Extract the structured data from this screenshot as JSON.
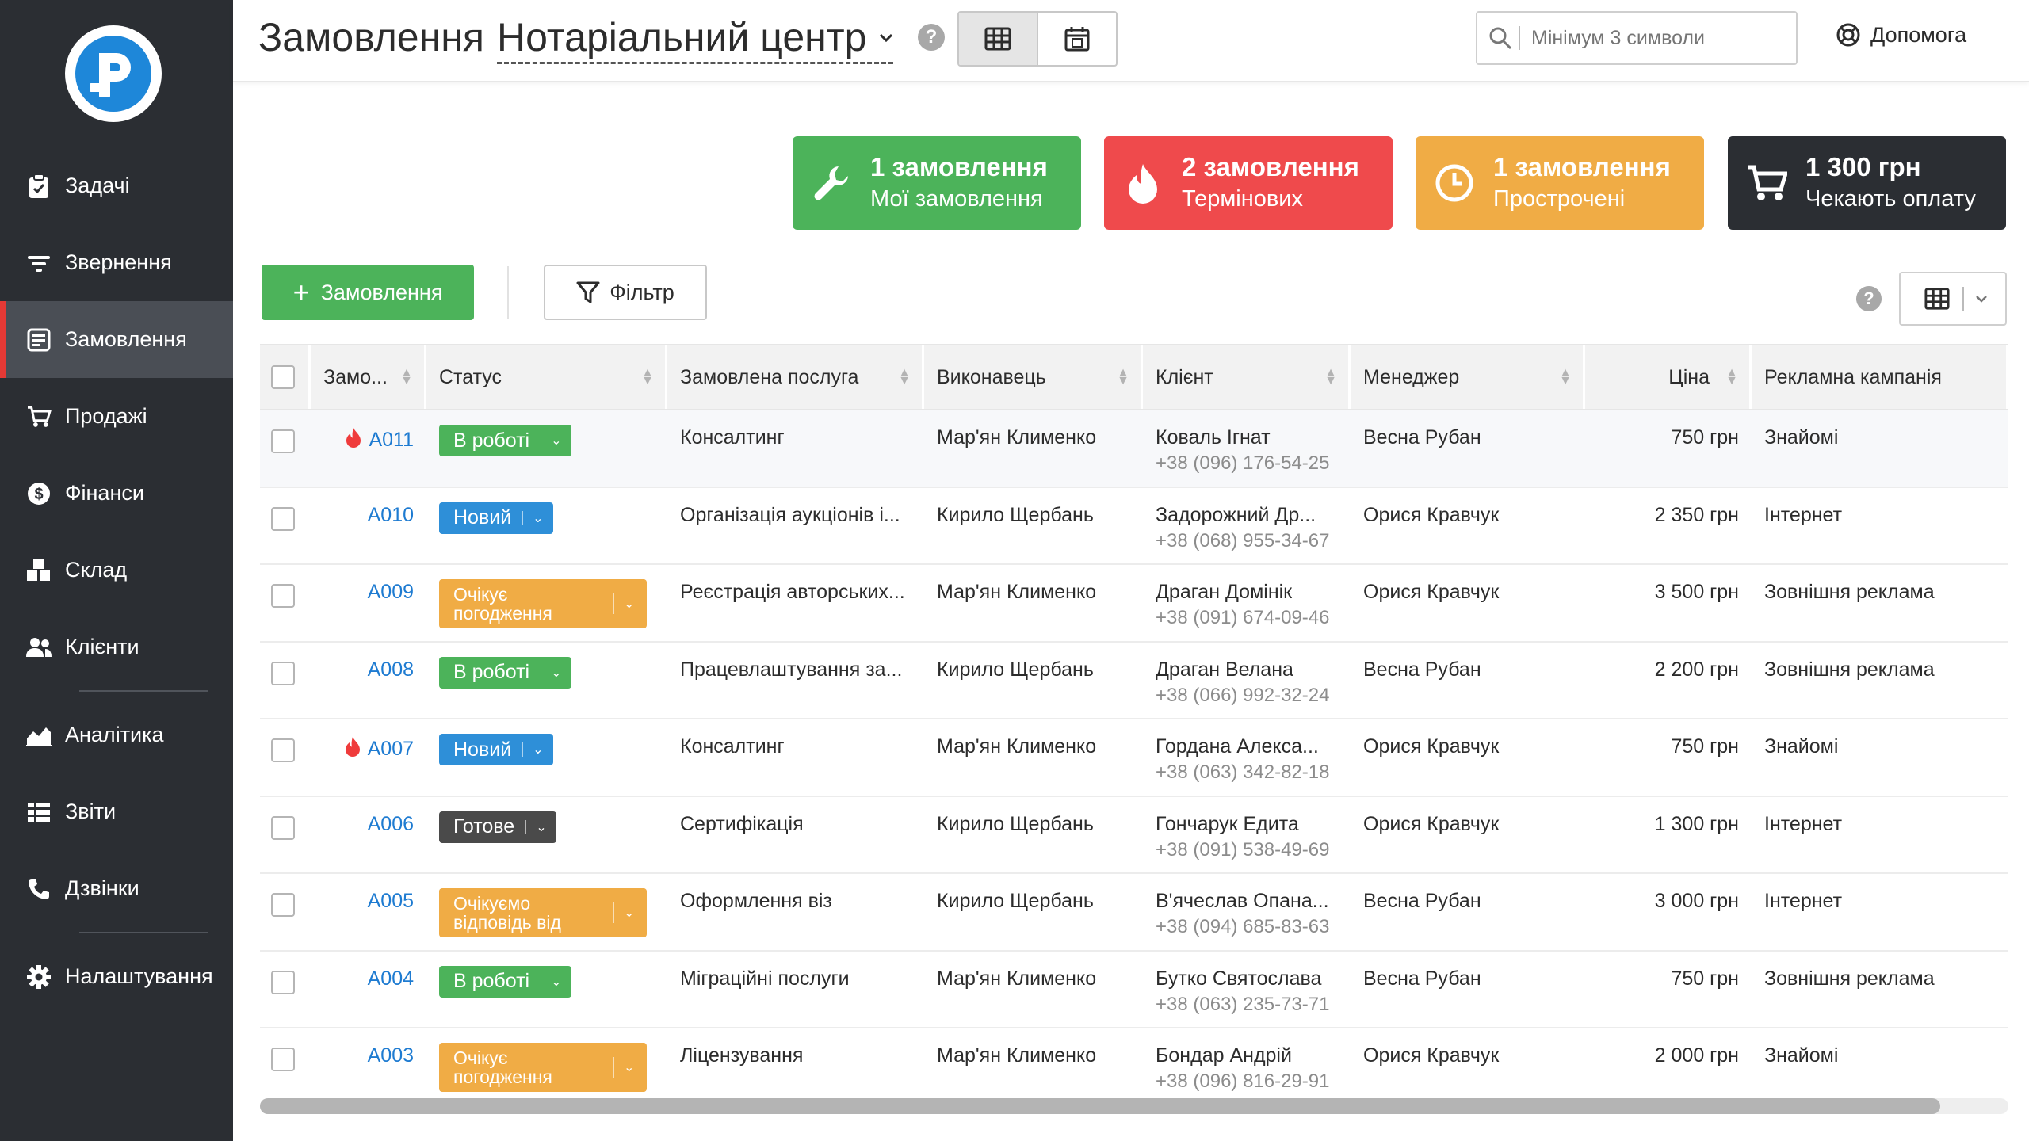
{
  "sidebar": {
    "items": [
      {
        "label": "Задачі",
        "icon": "clipboard-check-icon"
      },
      {
        "label": "Звернення",
        "icon": "filter-lines-icon"
      },
      {
        "label": "Замовлення",
        "icon": "order-form-icon",
        "active": true
      },
      {
        "label": "Продажі",
        "icon": "cart-icon"
      },
      {
        "label": "Фінанси",
        "icon": "dollar-coin-icon"
      },
      {
        "label": "Склад",
        "icon": "boxes-icon"
      },
      {
        "label": "Клієнти",
        "icon": "users-icon"
      },
      {
        "label": "Аналітика",
        "icon": "area-chart-icon"
      },
      {
        "label": "Звіти",
        "icon": "report-list-icon"
      },
      {
        "label": "Дзвінки",
        "icon": "phone-icon"
      },
      {
        "label": "Налаштування",
        "icon": "gear-icon"
      }
    ]
  },
  "header": {
    "title": "Замовлення",
    "organization": "Нотаріальний центр",
    "search_placeholder": "Мінімум 3 символи",
    "help_label": "Допомога"
  },
  "cards": [
    {
      "big": "1 замовлення",
      "small": "Мої замовлення",
      "color": "#4cb35a",
      "icon": "wrench-icon"
    },
    {
      "big": "2 замовлення",
      "small": "Термінових",
      "color": "#ef4a4c",
      "icon": "fire-icon"
    },
    {
      "big": "1 замовлення",
      "small": "Прострочені",
      "color": "#f0ac45",
      "icon": "clock-icon"
    },
    {
      "big": "1 300 грн",
      "small": "Чекають оплату",
      "color": "#2b2e33",
      "icon": "cart-icon"
    }
  ],
  "toolbar": {
    "add_label": "Замовлення",
    "filter_label": "Фільтр"
  },
  "table": {
    "columns": [
      "Замо...",
      "Статус",
      "Замовлена послуга",
      "Виконавець",
      "Клієнт",
      "Менеджер",
      "Ціна",
      "Рекламна кампанія"
    ],
    "rows": [
      {
        "id": "A011",
        "urgent": true,
        "status": "В роботі",
        "status_color": "green",
        "service": "Консалтинг",
        "executor": "Мар'ян Клименко",
        "client": "Коваль Ігнат",
        "phone": "+38 (096) 176-54-25",
        "manager": "Весна Рубан",
        "price": "750 грн",
        "campaign": "Знайомі"
      },
      {
        "id": "A010",
        "urgent": false,
        "status": "Новий",
        "status_color": "blue",
        "service": "Організація аукціонів і...",
        "executor": "Кирило Щербань",
        "client": "Задорожний Др...",
        "phone": "+38 (068) 955-34-67",
        "manager": "Орися Кравчук",
        "price": "2 350 грн",
        "campaign": "Інтернет"
      },
      {
        "id": "A009",
        "urgent": false,
        "status": "Очікує погодження",
        "status_color": "orange",
        "service": "Реєстрація авторських...",
        "executor": "Мар'ян Клименко",
        "client": "Драган Домінік",
        "phone": "+38 (091) 674-09-46",
        "manager": "Орися Кравчук",
        "price": "3 500 грн",
        "campaign": "Зовнішня реклама"
      },
      {
        "id": "A008",
        "urgent": false,
        "status": "В роботі",
        "status_color": "green",
        "service": "Працевлаштування за...",
        "executor": "Кирило Щербань",
        "client": "Драган Велана",
        "phone": "+38 (066) 992-32-24",
        "manager": "Весна Рубан",
        "price": "2 200 грн",
        "campaign": "Зовнішня реклама"
      },
      {
        "id": "A007",
        "urgent": true,
        "status": "Новий",
        "status_color": "blue",
        "service": "Консалтинг",
        "executor": "Мар'ян Клименко",
        "client": "Гордана Алекса...",
        "phone": "+38 (063) 342-82-18",
        "manager": "Орися Кравчук",
        "price": "750 грн",
        "campaign": "Знайомі"
      },
      {
        "id": "A006",
        "urgent": false,
        "status": "Готове",
        "status_color": "dark",
        "service": "Сертифікація",
        "executor": "Кирило Щербань",
        "client": "Гончарук Едита",
        "phone": "+38 (091) 538-49-69",
        "manager": "Орися Кравчук",
        "price": "1 300 грн",
        "campaign": "Інтернет"
      },
      {
        "id": "A005",
        "urgent": false,
        "status": "Очікуємо відповідь від",
        "status_color": "orange",
        "service": "Оформлення віз",
        "executor": "Кирило Щербань",
        "client": "В'ячеслав Опана...",
        "phone": "+38 (094) 685-83-63",
        "manager": "Весна Рубан",
        "price": "3 000 грн",
        "campaign": "Інтернет"
      },
      {
        "id": "A004",
        "urgent": false,
        "status": "В роботі",
        "status_color": "green",
        "service": "Міграційні послуги",
        "executor": "Мар'ян Клименко",
        "client": "Бутко Святослава",
        "phone": "+38 (063) 235-73-71",
        "manager": "Весна Рубан",
        "price": "750 грн",
        "campaign": "Зовнішня реклама"
      },
      {
        "id": "A003",
        "urgent": false,
        "status": "Очікує погодження",
        "status_color": "orange",
        "service": "Ліцензування",
        "executor": "Мар'ян Клименко",
        "client": "Бондар Андрій",
        "phone": "+38 (096) 816-29-91",
        "manager": "Орися Кравчук",
        "price": "2 000 грн",
        "campaign": "Знайомі"
      }
    ]
  }
}
